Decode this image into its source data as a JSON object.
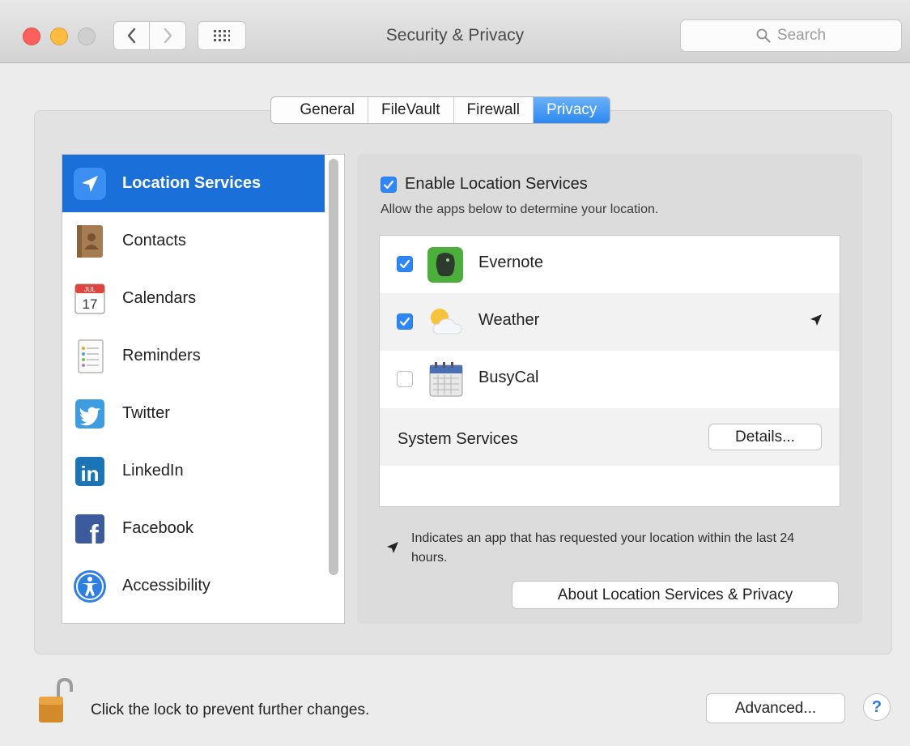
{
  "window": {
    "title": "Security & Privacy",
    "search_placeholder": "Search"
  },
  "tabs": [
    {
      "label": "General",
      "active": false
    },
    {
      "label": "FileVault",
      "active": false
    },
    {
      "label": "Firewall",
      "active": false
    },
    {
      "label": "Privacy",
      "active": true
    }
  ],
  "sidebar": {
    "items": [
      {
        "label": "Location Services",
        "icon": "location-arrow-icon",
        "selected": true
      },
      {
        "label": "Contacts",
        "icon": "contacts-book-icon",
        "selected": false
      },
      {
        "label": "Calendars",
        "icon": "calendar-icon",
        "selected": false
      },
      {
        "label": "Reminders",
        "icon": "reminders-list-icon",
        "selected": false
      },
      {
        "label": "Twitter",
        "icon": "twitter-bird-icon",
        "selected": false
      },
      {
        "label": "LinkedIn",
        "icon": "linkedin-icon",
        "selected": false
      },
      {
        "label": "Facebook",
        "icon": "facebook-icon",
        "selected": false
      },
      {
        "label": "Accessibility",
        "icon": "accessibility-icon",
        "selected": false
      }
    ],
    "calendar_month": "JUL",
    "calendar_day": "17",
    "linkedin_letters": "in",
    "facebook_letter": "f"
  },
  "location": {
    "enable_label": "Enable Location Services",
    "enable_checked": true,
    "description": "Allow the apps below to determine your location.",
    "apps": [
      {
        "name": "Evernote",
        "checked": true,
        "icon": "evernote-elephant-icon",
        "recent_request": false
      },
      {
        "name": "Weather",
        "checked": true,
        "icon": "weather-sun-cloud-icon",
        "recent_request": true
      },
      {
        "name": "BusyCal",
        "checked": false,
        "icon": "busycal-calendar-icon",
        "recent_request": false
      }
    ],
    "system_services_label": "System Services",
    "details_button": "Details...",
    "legend_text": "Indicates an app that has requested your location within the last 24 hours.",
    "about_button": "About Location Services & Privacy"
  },
  "footer": {
    "lock_text": "Click the lock to prevent further changes.",
    "advanced_button": "Advanced...",
    "help_button": "?"
  },
  "colors": {
    "accent": "#1a6fd8",
    "tab_active": "#2d88f0",
    "checkbox": "#2f87f5"
  }
}
